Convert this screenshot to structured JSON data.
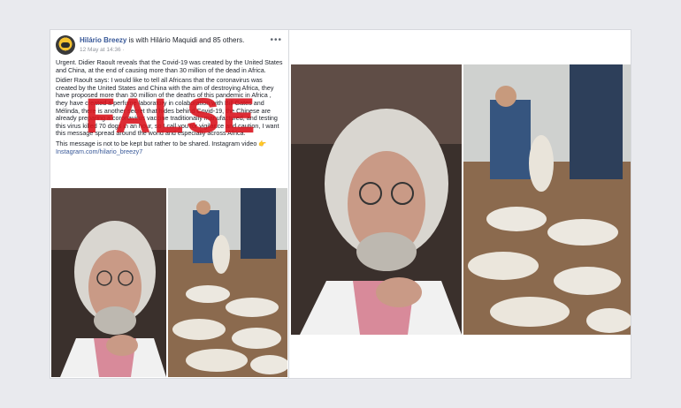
{
  "post": {
    "author": "Hilário Breezy",
    "with_text": "is with Hilário Maquidi and 85 others.",
    "date": "12 May at 14:36 ·",
    "more_label": "•••",
    "paragraph1": "Urgent. Didier Raoult reveals that the Covid-19 was created by the United States and China, at the end of causing more than 30 million of the dead in Africa.",
    "paragraph2": "Didier Raoult says: I would like to tell all Africans that the coronavirus was created by the United States and China with the aim of destroying Africa, they have proposed more than 30 million of the deaths of this pandemic in Africa , they have created a perfume laboratory in colaboration with Bill Gates and Mélinda, there is another secret that hides behind Covid-19, the Chinese are already preparing a coronavirus vaccine traditionally manufactured, and testing this virus killed 70 dogs in an hour, so I call you for vigilance and caution, I want this message spread around the world and especially across Africa.",
    "paragraph3": "This message is not to be kept but rather to be shared. Instagram video 👉",
    "link": "Instagram.com/hilario_breezy7"
  },
  "stamp": {
    "text": "FALSE",
    "color": "#dc141e"
  },
  "images": {
    "doctor_alt": "photo-man-white-hair-beard",
    "pangolin_alt": "photo-officers-pangolins"
  }
}
